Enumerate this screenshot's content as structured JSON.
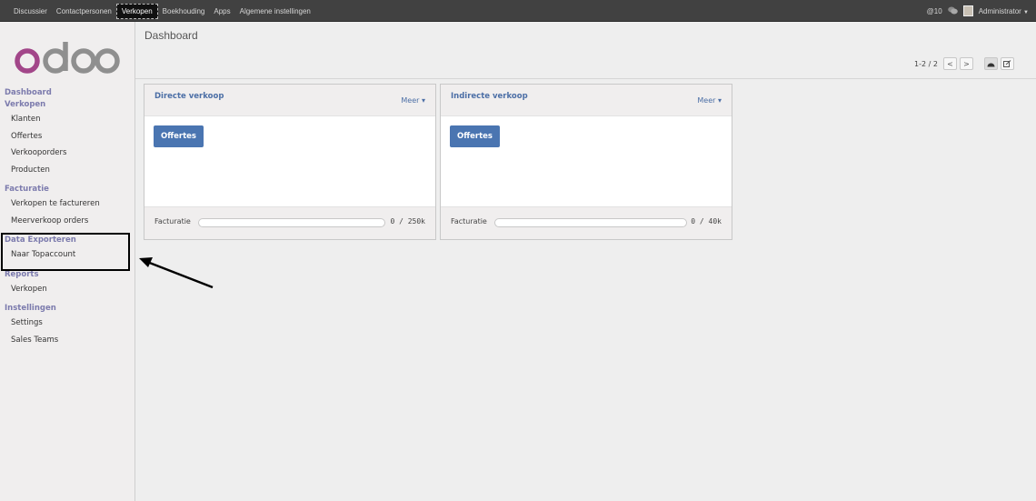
{
  "topbar": {
    "menu": [
      "Discussier",
      "Contactpersonen",
      "Verkopen",
      "Boekhouding",
      "Apps",
      "Algemene instellingen"
    ],
    "active_index": 2,
    "notifications": "@10",
    "user": "Administrator"
  },
  "sidebar": {
    "logo_text": "odoo",
    "sections": [
      {
        "header": "Dashboard",
        "items": []
      },
      {
        "header": "Verkopen",
        "items": [
          "Klanten",
          "Offertes",
          "Verkooporders",
          "Producten"
        ]
      },
      {
        "header": "Facturatie",
        "items": [
          "Verkopen te factureren",
          "Meerverkoop orders"
        ]
      },
      {
        "header": "Data Exporteren",
        "items": [
          "Naar Topaccount"
        ]
      },
      {
        "header": "Reports",
        "items": [
          "Verkopen"
        ]
      },
      {
        "header": "Instellingen",
        "items": [
          "Settings",
          "Sales Teams"
        ]
      }
    ]
  },
  "main": {
    "title": "Dashboard",
    "pager": "1-2 / 2",
    "cards": [
      {
        "title": "Directe verkoop",
        "more": "Meer",
        "button": "Offertes",
        "footer_label": "Facturatie",
        "progress": 0,
        "value": "0 / 250k"
      },
      {
        "title": "Indirecte verkoop",
        "more": "Meer",
        "button": "Offertes",
        "footer_label": "Facturatie",
        "progress": 0,
        "value": "0 / 40k"
      }
    ]
  },
  "colors": {
    "topbar": "#414141",
    "accent": "#4a75b1",
    "section_header": "#7c7bad",
    "logo_purple": "#a24689",
    "logo_gray": "#8f8f8f"
  }
}
